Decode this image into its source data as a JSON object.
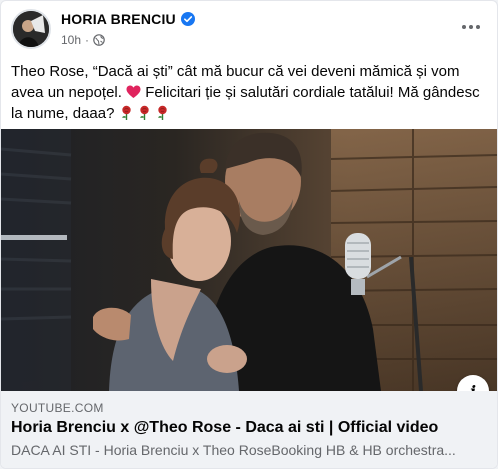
{
  "post": {
    "author": "HORIA BRENCIU",
    "time": "10h",
    "text_before_heart": "Theo Rose, “Dacă ai ști” cât mă bucur că vei deveni mămică și vom avea un nepoțel. ",
    "text_after_heart": " Felicitari ție și salutări cordiale tatălui! Mă gândesc la nume, daaa? ",
    "emojis": [
      "red-heart",
      "rose",
      "rose",
      "rose"
    ]
  },
  "link_preview": {
    "domain": "YOUTUBE.COM",
    "title": "Horia Brenciu x @Theo Rose - Daca ai sti | Official video",
    "description": "DACA AI STI - Horia Brenciu x Theo RoseBooking HB & HB orchestra..."
  },
  "colors": {
    "verified": "#1877f2",
    "secondary_text": "#65676b",
    "heart": "#e0245e",
    "rose": "#c62828"
  }
}
